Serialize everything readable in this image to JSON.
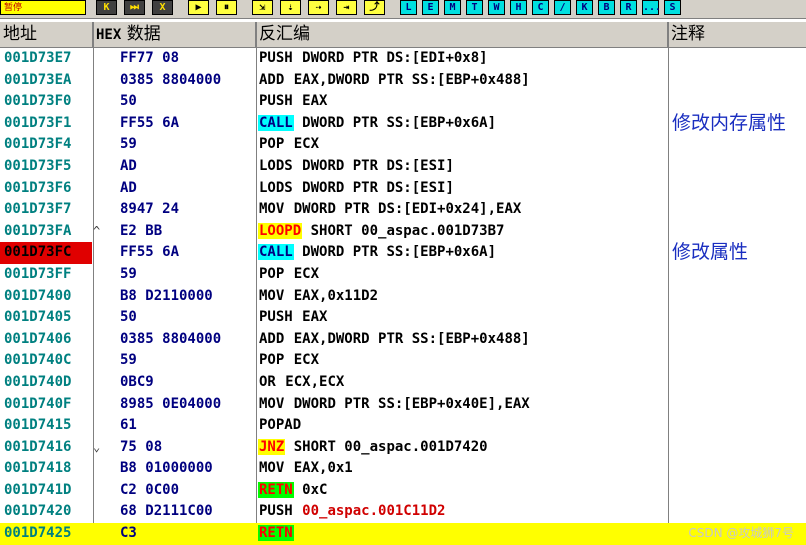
{
  "toolbar": {
    "status_text": "暂停",
    "buttons": [
      {
        "label": "K",
        "style": "dark"
      },
      {
        "label": "⏭",
        "style": "dark"
      },
      {
        "label": "X",
        "style": "dark"
      },
      {
        "label": "▶",
        "style": "yellow"
      },
      {
        "label": "⏸",
        "style": "yellow"
      },
      {
        "label": "⇲",
        "style": "yellow"
      },
      {
        "label": "⇣",
        "style": "yellow"
      },
      {
        "label": "⇢",
        "style": "yellow"
      },
      {
        "label": "⇥",
        "style": "yellow"
      },
      {
        "label": "⤴",
        "style": "yellow"
      },
      {
        "label": "L",
        "style": "cyan"
      },
      {
        "label": "E",
        "style": "cyan"
      },
      {
        "label": "M",
        "style": "cyan"
      },
      {
        "label": "T",
        "style": "cyan"
      },
      {
        "label": "W",
        "style": "cyan"
      },
      {
        "label": "H",
        "style": "cyan"
      },
      {
        "label": "C",
        "style": "cyan"
      },
      {
        "label": "/",
        "style": "cyan"
      },
      {
        "label": "K",
        "style": "cyan"
      },
      {
        "label": "B",
        "style": "cyan"
      },
      {
        "label": "R",
        "style": "cyan"
      },
      {
        "label": "...",
        "style": "cyan"
      },
      {
        "label": "S",
        "style": "cyan"
      }
    ]
  },
  "columns": {
    "address": "地址",
    "hex_prefix": "HEX",
    "hex_suffix": "数据",
    "disasm": "反汇编",
    "comment": "注释"
  },
  "rows": [
    {
      "addr": "001D73E7",
      "mark": "",
      "hex": "FF77 08",
      "mn": "PUSH",
      "mn_style": "",
      "ops": "DWORD PTR DS:[EDI+0x8]",
      "ops_red": false,
      "comment": "",
      "current": false,
      "eip": false
    },
    {
      "addr": "001D73EA",
      "mark": "",
      "hex": "0385 8804000",
      "mn": "ADD",
      "mn_style": "",
      "ops": "EAX,DWORD PTR SS:[EBP+0x488]",
      "ops_red": false,
      "comment": "",
      "current": false,
      "eip": false
    },
    {
      "addr": "001D73F0",
      "mark": "",
      "hex": "50",
      "mn": "PUSH",
      "mn_style": "",
      "ops": "EAX",
      "ops_red": false,
      "comment": "",
      "current": false,
      "eip": false
    },
    {
      "addr": "001D73F1",
      "mark": "",
      "hex": "FF55 6A",
      "mn": "CALL",
      "mn_style": "call",
      "ops": "DWORD PTR SS:[EBP+0x6A]",
      "ops_red": false,
      "comment": "修改内存属性",
      "current": false,
      "eip": false
    },
    {
      "addr": "001D73F4",
      "mark": "",
      "hex": "59",
      "mn": "POP",
      "mn_style": "",
      "ops": "ECX",
      "ops_red": false,
      "comment": "",
      "current": false,
      "eip": false
    },
    {
      "addr": "001D73F5",
      "mark": "",
      "hex": "AD",
      "mn": "LODS",
      "mn_style": "",
      "ops": "DWORD PTR DS:[ESI]",
      "ops_red": false,
      "comment": "",
      "current": false,
      "eip": false
    },
    {
      "addr": "001D73F6",
      "mark": "",
      "hex": "AD",
      "mn": "LODS",
      "mn_style": "",
      "ops": "DWORD PTR DS:[ESI]",
      "ops_red": false,
      "comment": "",
      "current": false,
      "eip": false
    },
    {
      "addr": "001D73F7",
      "mark": "",
      "hex": "8947 24",
      "mn": "MOV",
      "mn_style": "",
      "ops": "DWORD PTR DS:[EDI+0x24],EAX",
      "ops_red": false,
      "comment": "",
      "current": false,
      "eip": false
    },
    {
      "addr": "001D73FA",
      "mark": "^",
      "hex": "E2 BB",
      "mn": "LOOPD",
      "mn_style": "loop",
      "ops": "SHORT 00_aspac.001D73B7",
      "ops_red": false,
      "comment": "",
      "current": false,
      "eip": false
    },
    {
      "addr": "001D73FC",
      "mark": "",
      "hex": "FF55 6A",
      "mn": "CALL",
      "mn_style": "call",
      "ops": "DWORD PTR SS:[EBP+0x6A]",
      "ops_red": false,
      "comment": "修改属性",
      "current": false,
      "eip": true
    },
    {
      "addr": "001D73FF",
      "mark": "",
      "hex": "59",
      "mn": "POP",
      "mn_style": "",
      "ops": "ECX",
      "ops_red": false,
      "comment": "",
      "current": false,
      "eip": false
    },
    {
      "addr": "001D7400",
      "mark": "",
      "hex": "B8 D2110000",
      "mn": "MOV",
      "mn_style": "",
      "ops": "EAX,0x11D2",
      "ops_red": false,
      "comment": "",
      "current": false,
      "eip": false
    },
    {
      "addr": "001D7405",
      "mark": "",
      "hex": "50",
      "mn": "PUSH",
      "mn_style": "",
      "ops": "EAX",
      "ops_red": false,
      "comment": "",
      "current": false,
      "eip": false
    },
    {
      "addr": "001D7406",
      "mark": "",
      "hex": "0385 8804000",
      "mn": "ADD",
      "mn_style": "",
      "ops": "EAX,DWORD PTR SS:[EBP+0x488]",
      "ops_red": false,
      "comment": "",
      "current": false,
      "eip": false
    },
    {
      "addr": "001D740C",
      "mark": "",
      "hex": "59",
      "mn": "POP",
      "mn_style": "",
      "ops": "ECX",
      "ops_red": false,
      "comment": "",
      "current": false,
      "eip": false
    },
    {
      "addr": "001D740D",
      "mark": "",
      "hex": "0BC9",
      "mn": "OR",
      "mn_style": "",
      "ops": "ECX,ECX",
      "ops_red": false,
      "comment": "",
      "current": false,
      "eip": false
    },
    {
      "addr": "001D740F",
      "mark": "",
      "hex": "8985 0E04000",
      "mn": "MOV",
      "mn_style": "",
      "ops": "DWORD PTR SS:[EBP+0x40E],EAX",
      "ops_red": false,
      "comment": "",
      "current": false,
      "eip": false
    },
    {
      "addr": "001D7415",
      "mark": "",
      "hex": "61",
      "mn": "POPAD",
      "mn_style": "",
      "ops": "",
      "ops_red": false,
      "comment": "",
      "current": false,
      "eip": false
    },
    {
      "addr": "001D7416",
      "mark": "⌄",
      "hex": "75 08",
      "mn": "JNZ",
      "mn_style": "jcc",
      "ops": "SHORT 00_aspac.001D7420",
      "ops_red": false,
      "comment": "",
      "current": false,
      "eip": false
    },
    {
      "addr": "001D7418",
      "mark": "",
      "hex": "B8 01000000",
      "mn": "MOV",
      "mn_style": "",
      "ops": "EAX,0x1",
      "ops_red": false,
      "comment": "",
      "current": false,
      "eip": false
    },
    {
      "addr": "001D741D",
      "mark": "",
      "hex": "C2 0C00",
      "mn": "RETN",
      "mn_style": "ret",
      "ops": "0xC",
      "ops_red": false,
      "comment": "",
      "current": false,
      "eip": false
    },
    {
      "addr": "001D7420",
      "mark": "",
      "hex": "68 D2111C00",
      "mn": "PUSH",
      "mn_style": "",
      "ops": "00_aspac.001C11D2",
      "ops_red": true,
      "comment": "",
      "current": false,
      "eip": false
    },
    {
      "addr": "001D7425",
      "mark": "",
      "hex": "C3",
      "mn": "RETN",
      "mn_style": "ret",
      "ops": "",
      "ops_red": false,
      "comment": "",
      "current": true,
      "eip": false
    }
  ],
  "watermark": "CSDN @攻城狮7号"
}
